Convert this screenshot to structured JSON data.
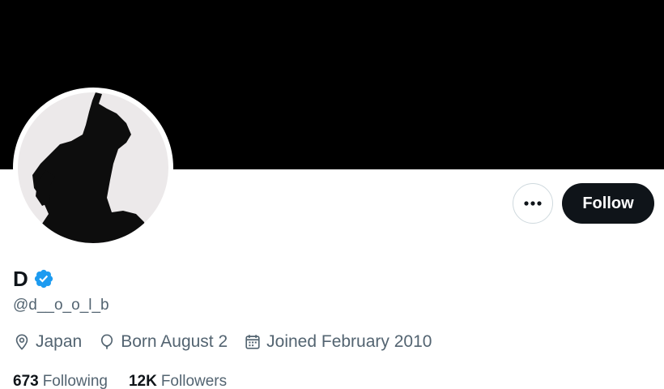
{
  "profile": {
    "display_name": "D",
    "handle": "@d__o_o_l_b",
    "location": "Japan",
    "birthday": "Born August 2",
    "joined": "Joined February 2010"
  },
  "actions": {
    "more_icon": "ellipsis-icon",
    "follow_label": "Follow"
  },
  "stats": {
    "following_count": "673",
    "following_label": "Following",
    "followers_count": "12K",
    "followers_label": "Followers"
  },
  "icons": {
    "verified": "verified-badge-icon",
    "location": "map-pin-icon",
    "birthday": "balloon-icon",
    "joined": "calendar-icon"
  },
  "colors": {
    "banner": "#000000",
    "verified": "#1d9bf0",
    "follow_button_bg": "#0f1419",
    "secondary_text": "#536471"
  }
}
